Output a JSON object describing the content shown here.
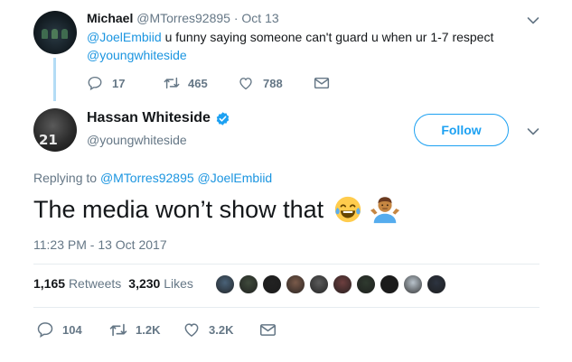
{
  "parent_tweet": {
    "name": "Michael",
    "handle": "@MTorres92895",
    "separator": "·",
    "date": "Oct 13",
    "text_mention": "@JoelEmbiid",
    "text_body": " u funny saying someone can't guard u when ur 1-7 respect",
    "text_mention2": "@youngwhiteside",
    "replies": "17",
    "retweets": "465",
    "likes": "788"
  },
  "main_tweet": {
    "name": "Hassan Whiteside",
    "handle": "@youngwhiteside",
    "avatar_jersey": "21",
    "follow_label": "Follow",
    "replying_prefix": "Replying to",
    "replying_to_1": "@MTorres92895",
    "replying_to_2": "@JoelEmbiid",
    "text": "The media won’t show that",
    "emoji_1": "😂",
    "emoji_2": "🤷🏽‍♂️",
    "timestamp": "11:23 PM - 13 Oct 2017",
    "retweets_count": "1,165",
    "retweets_label": "Retweets",
    "likes_count": "3,230",
    "likes_label": "Likes",
    "replies": "104",
    "retweets_short": "1.2K",
    "likes_short": "3.2K"
  },
  "colors": {
    "accent": "#1da1f2",
    "link": "#1b95e0",
    "muted": "#657786",
    "verified": "#1da1f2",
    "thread_line": "#b4dcf5"
  },
  "liker_avatar_colors": [
    "#4a6278",
    "#3f4a3c",
    "#222222",
    "#7a5a4a",
    "#5b5b5b",
    "#6d3f3f",
    "#2f3a2f",
    "#1c1c1c",
    "#b9c3cb",
    "#2d3440"
  ]
}
